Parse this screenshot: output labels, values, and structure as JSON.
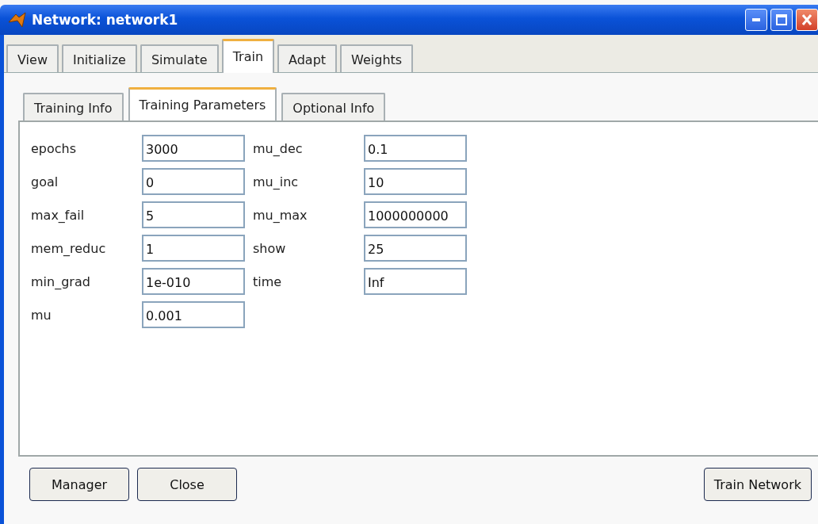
{
  "window": {
    "title": "Network: network1"
  },
  "tabs": [
    {
      "label": "View",
      "selected": false
    },
    {
      "label": "Initialize",
      "selected": false
    },
    {
      "label": "Simulate",
      "selected": false
    },
    {
      "label": "Train",
      "selected": true
    },
    {
      "label": "Adapt",
      "selected": false
    },
    {
      "label": "Weights",
      "selected": false
    }
  ],
  "subtabs": [
    {
      "label": "Training Info",
      "selected": false
    },
    {
      "label": "Training Parameters",
      "selected": true
    },
    {
      "label": "Optional Info",
      "selected": false
    }
  ],
  "parameters": [
    {
      "label": "epochs",
      "value": "3000"
    },
    {
      "label": "mu_dec",
      "value": "0.1"
    },
    {
      "label": "goal",
      "value": "0"
    },
    {
      "label": "mu_inc",
      "value": "10"
    },
    {
      "label": "max_fail",
      "value": "5"
    },
    {
      "label": "mu_max",
      "value": "1000000000"
    },
    {
      "label": "mem_reduc",
      "value": "1"
    },
    {
      "label": "show",
      "value": "25"
    },
    {
      "label": "min_grad",
      "value": "1e-010"
    },
    {
      "label": "time",
      "value": "Inf"
    },
    {
      "label": "mu",
      "value": "0.001"
    }
  ],
  "buttons_left": [
    "Manager",
    "Close"
  ],
  "buttons_right": [
    "Train Network"
  ]
}
